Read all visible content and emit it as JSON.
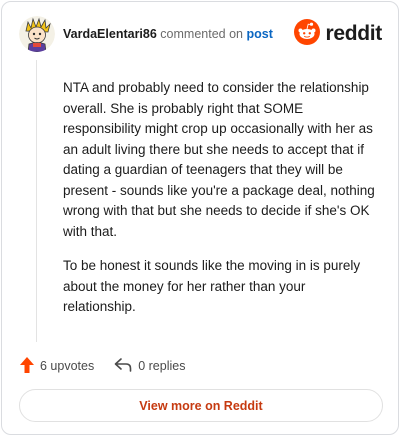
{
  "comment": {
    "username": "VardaElentari86",
    "action_text": "commented on",
    "post_link_text": "post",
    "paragraphs": [
      "NTA and probably need to consider the relationship overall. She is probably right that SOME responsibility might crop up occasionally with her as an adult living there but she needs to accept that if dating a guardian of teenagers that they will be present - sounds like you're a package deal, nothing wrong with that but she needs to decide if she's OK with that.",
      "To be honest it sounds like the moving in is purely about the money for her rather than your relationship."
    ]
  },
  "brand": {
    "name": "reddit",
    "icon": "reddit-snoo-icon",
    "color": "#ff4500"
  },
  "actions": {
    "upvotes_label": "6 upvotes",
    "upvote_icon": "upvote-arrow-icon",
    "replies_label": "0 replies",
    "reply_icon": "reply-arrow-icon",
    "upvote_color": "#ff4500"
  },
  "footer": {
    "view_more_label": "View more on Reddit",
    "view_more_color": "#c63a10"
  }
}
